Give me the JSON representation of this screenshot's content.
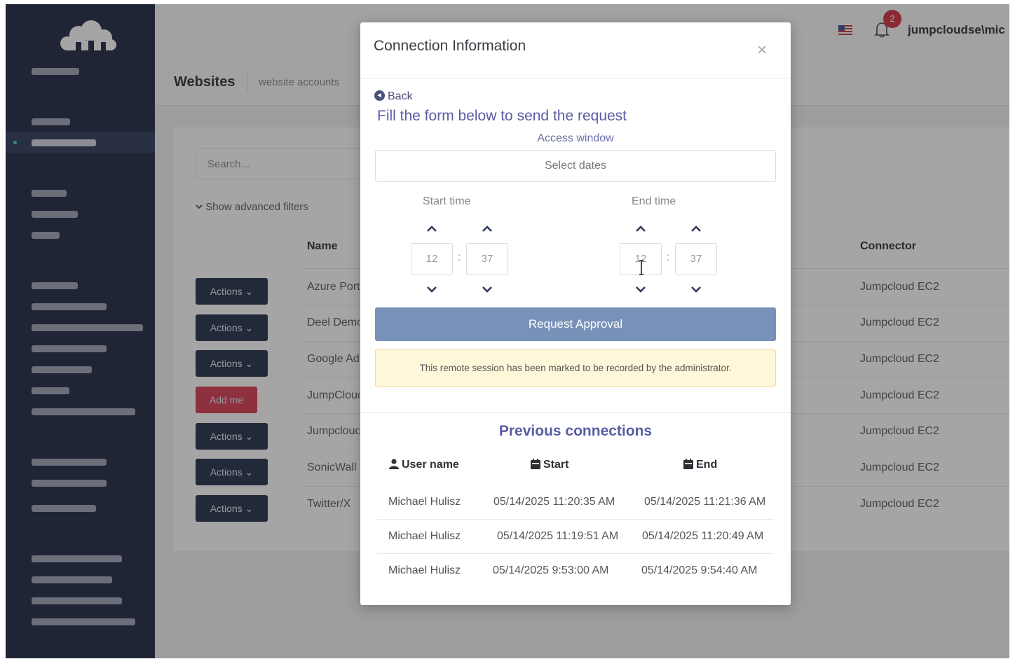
{
  "header": {
    "username": "jumpcloudse\\mic",
    "notification_count": "2"
  },
  "breadcrumb": {
    "title": "Websites",
    "subtitle": "website accounts"
  },
  "list": {
    "search_placeholder": "Search...",
    "advanced_filters_label": "Show advanced filters",
    "columns": {
      "name": "Name",
      "connector": "Connector"
    },
    "rows": [
      {
        "action": "Actions",
        "name": "Azure Portal",
        "connector": "Jumpcloud EC2"
      },
      {
        "action": "Actions",
        "name": "Deel Demo",
        "connector": "Jumpcloud EC2"
      },
      {
        "action": "Actions",
        "name": "Google Admin",
        "connector": "Jumpcloud EC2"
      },
      {
        "action": "Add me",
        "name": "JumpCloud",
        "connector": "Jumpcloud EC2"
      },
      {
        "action": "Actions",
        "name": "Jumpcloud",
        "connector": "Jumpcloud EC2"
      },
      {
        "action": "Actions",
        "name": "SonicWall",
        "connector": "Jumpcloud EC2"
      },
      {
        "action": "Actions",
        "name": "Twitter/X",
        "connector": "Jumpcloud EC2"
      }
    ]
  },
  "modal": {
    "title": "Connection Information",
    "close": "×",
    "back": "Back",
    "form_title": "Fill the form below to send the request",
    "access_window_label": "Access window",
    "select_dates": "Select dates",
    "start_time_label": "Start time",
    "end_time_label": "End time",
    "start_hour": "12",
    "start_minute": "37",
    "end_hour": "12",
    "end_minute": "37",
    "time_separator": ":",
    "request_button": "Request Approval",
    "recording_notice": "This remote session has been marked to be recorded by the administrator.",
    "previous_title": "Previous connections",
    "columns": {
      "user": "User name",
      "start": "Start",
      "end": "End"
    },
    "connections": [
      {
        "user": "Michael Hulisz",
        "start": "05/14/2025 11:20:35 AM",
        "end": "05/14/2025 11:21:36 AM"
      },
      {
        "user": "Michael Hulisz",
        "start": "05/14/2025 11:19:51 AM",
        "end": "05/14/2025 11:20:49 AM"
      },
      {
        "user": "Michael Hulisz",
        "start": "05/14/2025 9:53:00 AM",
        "end": "05/14/2025 9:54:40 AM"
      }
    ]
  },
  "colors": {
    "sidebar": "#1b2440",
    "action_button": "#1e2b47",
    "add_me_button": "#d8364e",
    "request_button": "#7791b8",
    "accent_text": "#5a5da4"
  },
  "icons": [
    "cloud-logo-icon",
    "flag-icon",
    "bell-icon",
    "back-circle-icon",
    "chevron-up-icon",
    "chevron-down-icon",
    "user-icon",
    "calendar-icon",
    "close-icon",
    "text-cursor-icon"
  ]
}
